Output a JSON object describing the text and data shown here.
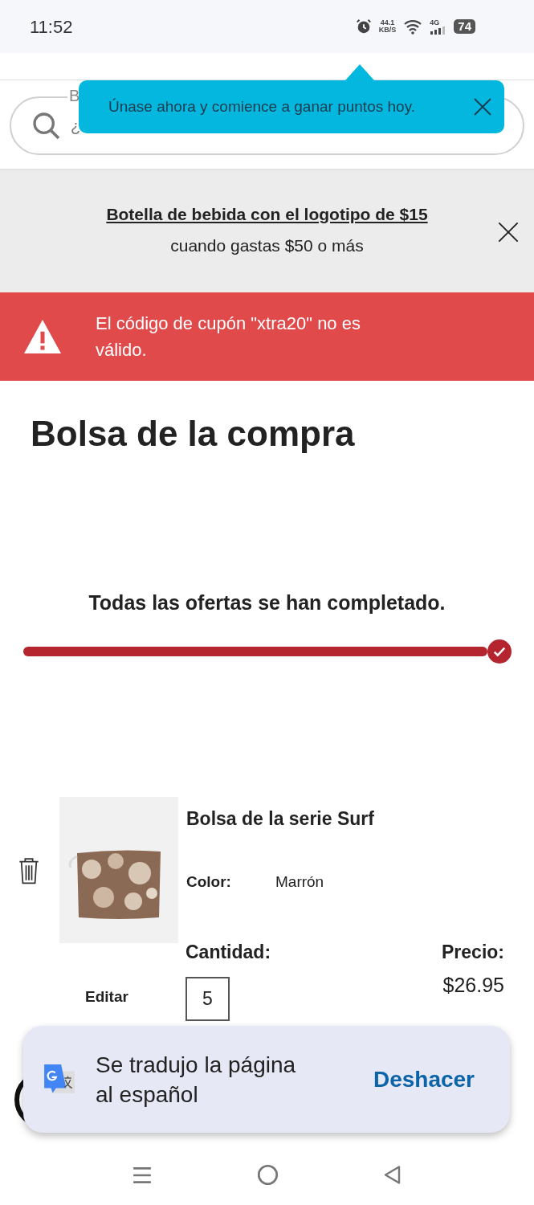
{
  "status_bar": {
    "time": "11:52",
    "net_speed": "44.1",
    "net_unit": "KB/S",
    "network": "4G",
    "battery": "74"
  },
  "search": {
    "label": "B",
    "placeholder": "¿"
  },
  "tooltip": {
    "text": "Únase ahora y comience a ganar puntos hoy."
  },
  "promo": {
    "link": "Botella de bebida con el logotipo de $15",
    "text": "cuando gastas $50 o más"
  },
  "error": {
    "text": "El código de cupón \"xtra20\" no es válido."
  },
  "title": "Bolsa de la compra",
  "offers": {
    "text": "Todas las ofertas se han completado.",
    "level": 1,
    "complete": true
  },
  "items": [
    {
      "name": "Bolsa de la serie Surf",
      "color_label": "Color:",
      "color_value": "Marrón",
      "edit": "Editar",
      "qty_label": "Cantidad:",
      "qty": "5",
      "price_label": "Precio:",
      "price": "$26.95"
    }
  ],
  "toast": {
    "text": "Se tradujo la página al español",
    "action": "Deshacer"
  }
}
